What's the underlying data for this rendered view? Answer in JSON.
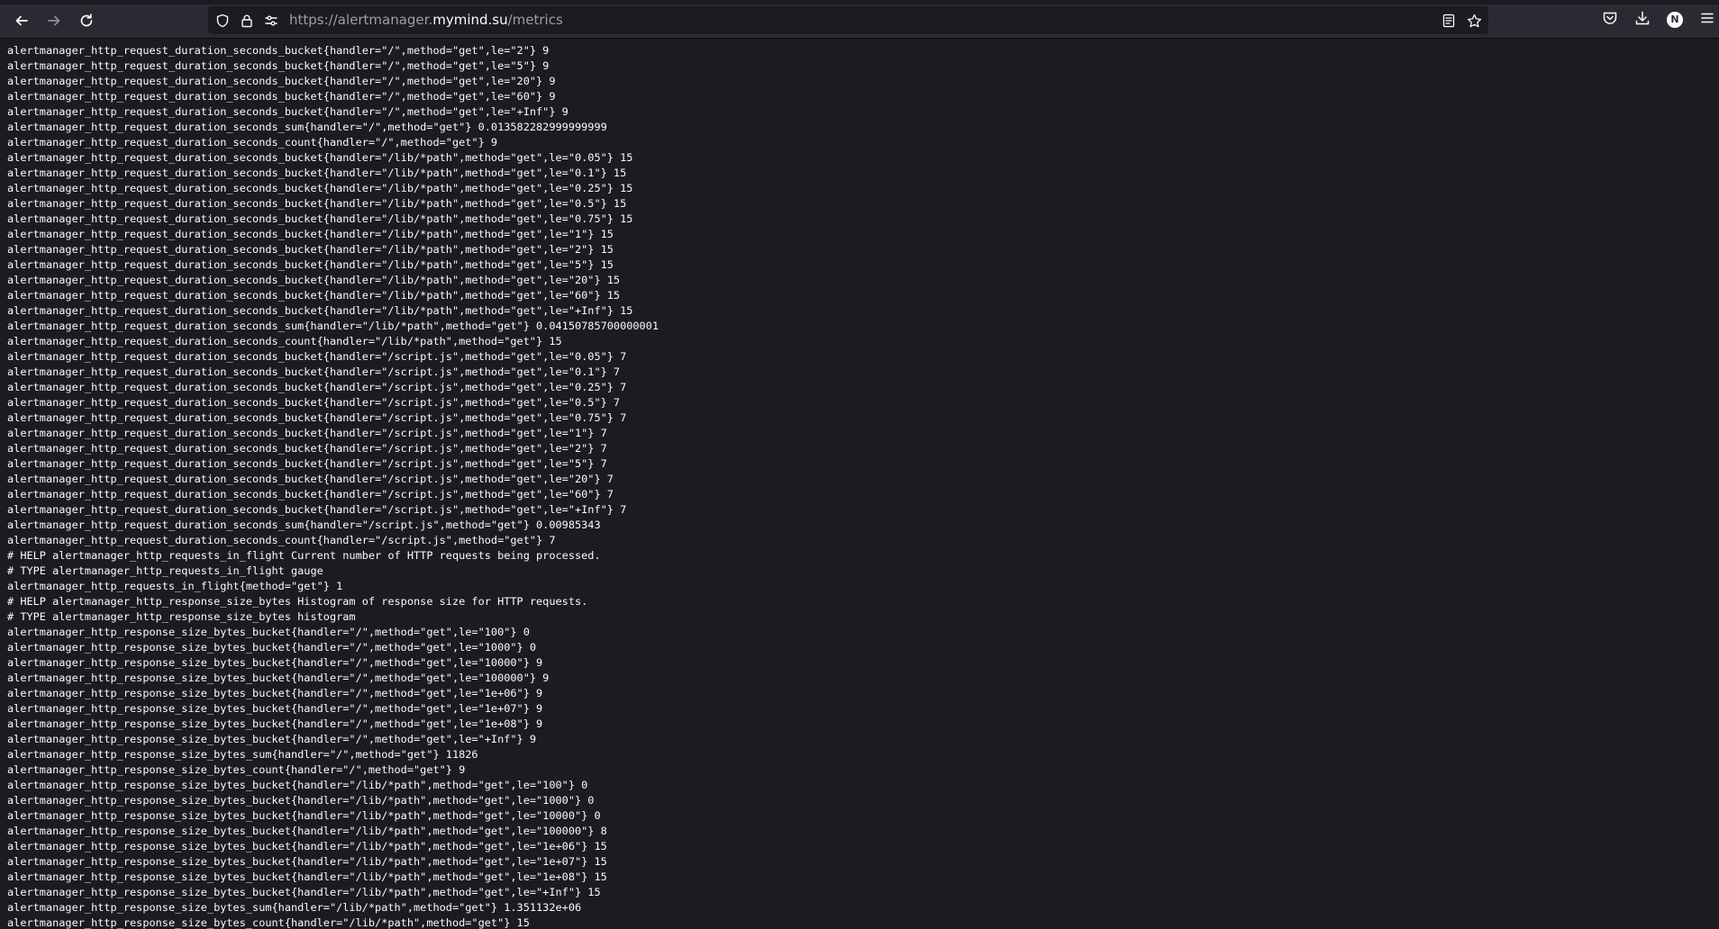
{
  "browser": {
    "url_prefix": "https://alertmanager.",
    "url_domain": "mymind.su",
    "url_path": "/metrics",
    "profile_initial": "N",
    "icons": {
      "back": "arrow-left-icon",
      "forward": "arrow-right-icon",
      "reload": "reload-icon",
      "tracking": "shield-icon",
      "lock": "lock-icon",
      "permissions": "sliders-icon",
      "reader": "reader-view-icon",
      "bookmark": "star-icon",
      "pocket": "pocket-icon",
      "downloads": "download-icon",
      "account": "account-avatar-icon",
      "menu": "hamburger-menu-icon"
    }
  },
  "page": {
    "lines": [
      "alertmanager_http_request_duration_seconds_bucket{handler=\"/\",method=\"get\",le=\"2\"} 9",
      "alertmanager_http_request_duration_seconds_bucket{handler=\"/\",method=\"get\",le=\"5\"} 9",
      "alertmanager_http_request_duration_seconds_bucket{handler=\"/\",method=\"get\",le=\"20\"} 9",
      "alertmanager_http_request_duration_seconds_bucket{handler=\"/\",method=\"get\",le=\"60\"} 9",
      "alertmanager_http_request_duration_seconds_bucket{handler=\"/\",method=\"get\",le=\"+Inf\"} 9",
      "alertmanager_http_request_duration_seconds_sum{handler=\"/\",method=\"get\"} 0.013582282999999999",
      "alertmanager_http_request_duration_seconds_count{handler=\"/\",method=\"get\"} 9",
      "alertmanager_http_request_duration_seconds_bucket{handler=\"/lib/*path\",method=\"get\",le=\"0.05\"} 15",
      "alertmanager_http_request_duration_seconds_bucket{handler=\"/lib/*path\",method=\"get\",le=\"0.1\"} 15",
      "alertmanager_http_request_duration_seconds_bucket{handler=\"/lib/*path\",method=\"get\",le=\"0.25\"} 15",
      "alertmanager_http_request_duration_seconds_bucket{handler=\"/lib/*path\",method=\"get\",le=\"0.5\"} 15",
      "alertmanager_http_request_duration_seconds_bucket{handler=\"/lib/*path\",method=\"get\",le=\"0.75\"} 15",
      "alertmanager_http_request_duration_seconds_bucket{handler=\"/lib/*path\",method=\"get\",le=\"1\"} 15",
      "alertmanager_http_request_duration_seconds_bucket{handler=\"/lib/*path\",method=\"get\",le=\"2\"} 15",
      "alertmanager_http_request_duration_seconds_bucket{handler=\"/lib/*path\",method=\"get\",le=\"5\"} 15",
      "alertmanager_http_request_duration_seconds_bucket{handler=\"/lib/*path\",method=\"get\",le=\"20\"} 15",
      "alertmanager_http_request_duration_seconds_bucket{handler=\"/lib/*path\",method=\"get\",le=\"60\"} 15",
      "alertmanager_http_request_duration_seconds_bucket{handler=\"/lib/*path\",method=\"get\",le=\"+Inf\"} 15",
      "alertmanager_http_request_duration_seconds_sum{handler=\"/lib/*path\",method=\"get\"} 0.04150785700000001",
      "alertmanager_http_request_duration_seconds_count{handler=\"/lib/*path\",method=\"get\"} 15",
      "alertmanager_http_request_duration_seconds_bucket{handler=\"/script.js\",method=\"get\",le=\"0.05\"} 7",
      "alertmanager_http_request_duration_seconds_bucket{handler=\"/script.js\",method=\"get\",le=\"0.1\"} 7",
      "alertmanager_http_request_duration_seconds_bucket{handler=\"/script.js\",method=\"get\",le=\"0.25\"} 7",
      "alertmanager_http_request_duration_seconds_bucket{handler=\"/script.js\",method=\"get\",le=\"0.5\"} 7",
      "alertmanager_http_request_duration_seconds_bucket{handler=\"/script.js\",method=\"get\",le=\"0.75\"} 7",
      "alertmanager_http_request_duration_seconds_bucket{handler=\"/script.js\",method=\"get\",le=\"1\"} 7",
      "alertmanager_http_request_duration_seconds_bucket{handler=\"/script.js\",method=\"get\",le=\"2\"} 7",
      "alertmanager_http_request_duration_seconds_bucket{handler=\"/script.js\",method=\"get\",le=\"5\"} 7",
      "alertmanager_http_request_duration_seconds_bucket{handler=\"/script.js\",method=\"get\",le=\"20\"} 7",
      "alertmanager_http_request_duration_seconds_bucket{handler=\"/script.js\",method=\"get\",le=\"60\"} 7",
      "alertmanager_http_request_duration_seconds_bucket{handler=\"/script.js\",method=\"get\",le=\"+Inf\"} 7",
      "alertmanager_http_request_duration_seconds_sum{handler=\"/script.js\",method=\"get\"} 0.00985343",
      "alertmanager_http_request_duration_seconds_count{handler=\"/script.js\",method=\"get\"} 7",
      "# HELP alertmanager_http_requests_in_flight Current number of HTTP requests being processed.",
      "# TYPE alertmanager_http_requests_in_flight gauge",
      "alertmanager_http_requests_in_flight{method=\"get\"} 1",
      "# HELP alertmanager_http_response_size_bytes Histogram of response size for HTTP requests.",
      "# TYPE alertmanager_http_response_size_bytes histogram",
      "alertmanager_http_response_size_bytes_bucket{handler=\"/\",method=\"get\",le=\"100\"} 0",
      "alertmanager_http_response_size_bytes_bucket{handler=\"/\",method=\"get\",le=\"1000\"} 0",
      "alertmanager_http_response_size_bytes_bucket{handler=\"/\",method=\"get\",le=\"10000\"} 9",
      "alertmanager_http_response_size_bytes_bucket{handler=\"/\",method=\"get\",le=\"100000\"} 9",
      "alertmanager_http_response_size_bytes_bucket{handler=\"/\",method=\"get\",le=\"1e+06\"} 9",
      "alertmanager_http_response_size_bytes_bucket{handler=\"/\",method=\"get\",le=\"1e+07\"} 9",
      "alertmanager_http_response_size_bytes_bucket{handler=\"/\",method=\"get\",le=\"1e+08\"} 9",
      "alertmanager_http_response_size_bytes_bucket{handler=\"/\",method=\"get\",le=\"+Inf\"} 9",
      "alertmanager_http_response_size_bytes_sum{handler=\"/\",method=\"get\"} 11826",
      "alertmanager_http_response_size_bytes_count{handler=\"/\",method=\"get\"} 9",
      "alertmanager_http_response_size_bytes_bucket{handler=\"/lib/*path\",method=\"get\",le=\"100\"} 0",
      "alertmanager_http_response_size_bytes_bucket{handler=\"/lib/*path\",method=\"get\",le=\"1000\"} 0",
      "alertmanager_http_response_size_bytes_bucket{handler=\"/lib/*path\",method=\"get\",le=\"10000\"} 0",
      "alertmanager_http_response_size_bytes_bucket{handler=\"/lib/*path\",method=\"get\",le=\"100000\"} 8",
      "alertmanager_http_response_size_bytes_bucket{handler=\"/lib/*path\",method=\"get\",le=\"1e+06\"} 15",
      "alertmanager_http_response_size_bytes_bucket{handler=\"/lib/*path\",method=\"get\",le=\"1e+07\"} 15",
      "alertmanager_http_response_size_bytes_bucket{handler=\"/lib/*path\",method=\"get\",le=\"1e+08\"} 15",
      "alertmanager_http_response_size_bytes_bucket{handler=\"/lib/*path\",method=\"get\",le=\"+Inf\"} 15",
      "alertmanager_http_response_size_bytes_sum{handler=\"/lib/*path\",method=\"get\"} 1.351132e+06",
      "alertmanager_http_response_size_bytes_count{handler=\"/lib/*path\",method=\"get\"} 15"
    ]
  }
}
